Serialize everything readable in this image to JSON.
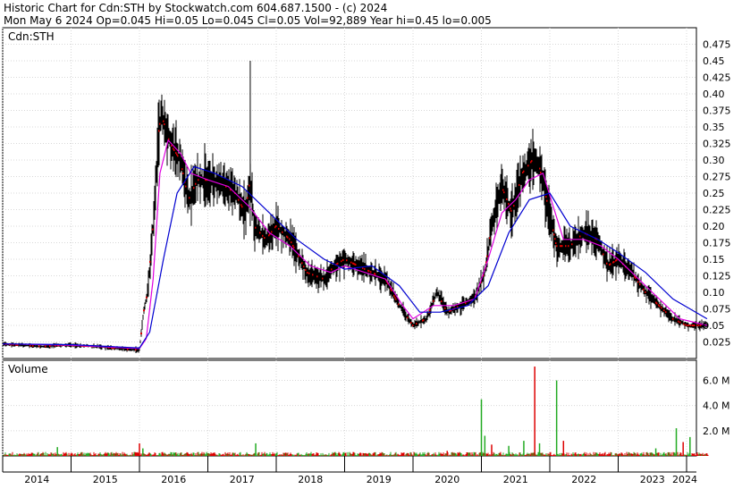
{
  "header": {
    "line1": "Historic Chart for Cdn:STH by Stockwatch.com 604.687.1500 - (c) 2024",
    "line2": "Mon May  6 2024   Op=0.045   Hi=0.05   Lo=0.045   Cl=0.05   Vol=92,889   Year hi=0.45   lo=0.005"
  },
  "colors": {
    "price_bar": "#000000",
    "down_mark": "#e00000",
    "ma_short": "#e000e0",
    "ma_long": "#0000d0",
    "vol_up": "#22aa22",
    "vol_down": "#dd0000",
    "grid": "#d8d8d8",
    "frame": "#000000"
  },
  "chart_data": [
    {
      "type": "line",
      "title": "Cdn:STH",
      "x_unit": "year",
      "xlim": [
        2014,
        2024.35
      ],
      "ylim": [
        0,
        0.5
      ],
      "grid": true,
      "y_ticks": [
        "0.025",
        "0.05",
        "0.075",
        "0.10",
        "0.125",
        "0.15",
        "0.175",
        "0.20",
        "0.225",
        "0.25",
        "0.275",
        "0.30",
        "0.325",
        "0.35",
        "0.375",
        "0.40",
        "0.425",
        "0.45",
        "0.475"
      ],
      "x_ticks": [
        "2014",
        "2015",
        "2016",
        "2017",
        "2018",
        "2019",
        "2020",
        "2021",
        "2022",
        "2023",
        "2024"
      ],
      "series": [
        {
          "role": "price",
          "points": [
            [
              2014.0,
              0.022
            ],
            [
              2014.3,
              0.02
            ],
            [
              2014.6,
              0.018
            ],
            [
              2014.85,
              0.02
            ],
            [
              2015.0,
              0.02
            ],
            [
              2015.4,
              0.018
            ],
            [
              2015.8,
              0.014
            ],
            [
              2016.0,
              0.013
            ],
            [
              2016.06,
              0.07
            ],
            [
              2016.12,
              0.1
            ],
            [
              2016.2,
              0.2
            ],
            [
              2016.27,
              0.33
            ],
            [
              2016.32,
              0.37
            ],
            [
              2016.45,
              0.325
            ],
            [
              2016.6,
              0.3
            ],
            [
              2016.72,
              0.24
            ],
            [
              2016.85,
              0.27
            ],
            [
              2017.0,
              0.27
            ],
            [
              2017.2,
              0.265
            ],
            [
              2017.4,
              0.25
            ],
            [
              2017.55,
              0.22
            ],
            [
              2017.62,
              0.27
            ],
            [
              2017.68,
              0.2
            ],
            [
              2017.85,
              0.18
            ],
            [
              2018.0,
              0.2
            ],
            [
              2018.2,
              0.18
            ],
            [
              2018.45,
              0.13
            ],
            [
              2018.7,
              0.12
            ],
            [
              2018.85,
              0.14
            ],
            [
              2019.0,
              0.15
            ],
            [
              2019.2,
              0.14
            ],
            [
              2019.4,
              0.13
            ],
            [
              2019.6,
              0.12
            ],
            [
              2019.8,
              0.08
            ],
            [
              2020.0,
              0.05
            ],
            [
              2020.2,
              0.06
            ],
            [
              2020.35,
              0.1
            ],
            [
              2020.5,
              0.07
            ],
            [
              2020.7,
              0.08
            ],
            [
              2020.9,
              0.09
            ],
            [
              2021.05,
              0.13
            ],
            [
              2021.15,
              0.2
            ],
            [
              2021.3,
              0.26
            ],
            [
              2021.45,
              0.22
            ],
            [
              2021.6,
              0.28
            ],
            [
              2021.75,
              0.3
            ],
            [
              2021.85,
              0.29
            ],
            [
              2022.0,
              0.22
            ],
            [
              2022.1,
              0.17
            ],
            [
              2022.3,
              0.17
            ],
            [
              2022.5,
              0.19
            ],
            [
              2022.7,
              0.18
            ],
            [
              2022.85,
              0.14
            ],
            [
              2023.0,
              0.15
            ],
            [
              2023.2,
              0.13
            ],
            [
              2023.4,
              0.1
            ],
            [
              2023.6,
              0.08
            ],
            [
              2023.8,
              0.06
            ],
            [
              2024.0,
              0.05
            ],
            [
              2024.3,
              0.05
            ]
          ]
        },
        {
          "role": "moving-average-short",
          "points": [
            [
              2014.0,
              0.022
            ],
            [
              2015.0,
              0.02
            ],
            [
              2016.0,
              0.015
            ],
            [
              2016.1,
              0.03
            ],
            [
              2016.2,
              0.12
            ],
            [
              2016.3,
              0.28
            ],
            [
              2016.42,
              0.33
            ],
            [
              2016.6,
              0.31
            ],
            [
              2016.75,
              0.28
            ],
            [
              2017.0,
              0.27
            ],
            [
              2017.3,
              0.26
            ],
            [
              2017.6,
              0.23
            ],
            [
              2017.9,
              0.19
            ],
            [
              2018.2,
              0.17
            ],
            [
              2018.5,
              0.14
            ],
            [
              2018.8,
              0.13
            ],
            [
              2019.0,
              0.14
            ],
            [
              2019.3,
              0.13
            ],
            [
              2019.6,
              0.12
            ],
            [
              2019.85,
              0.08
            ],
            [
              2020.0,
              0.06
            ],
            [
              2020.3,
              0.08
            ],
            [
              2020.6,
              0.08
            ],
            [
              2020.9,
              0.09
            ],
            [
              2021.1,
              0.15
            ],
            [
              2021.3,
              0.22
            ],
            [
              2021.5,
              0.24
            ],
            [
              2021.7,
              0.27
            ],
            [
              2021.9,
              0.28
            ],
            [
              2022.05,
              0.23
            ],
            [
              2022.2,
              0.18
            ],
            [
              2022.5,
              0.18
            ],
            [
              2022.75,
              0.17
            ],
            [
              2023.0,
              0.15
            ],
            [
              2023.3,
              0.12
            ],
            [
              2023.6,
              0.09
            ],
            [
              2023.9,
              0.06
            ],
            [
              2024.3,
              0.05
            ]
          ]
        },
        {
          "role": "moving-average-long",
          "points": [
            [
              2014.0,
              0.022
            ],
            [
              2015.0,
              0.021
            ],
            [
              2016.0,
              0.016
            ],
            [
              2016.15,
              0.04
            ],
            [
              2016.35,
              0.15
            ],
            [
              2016.55,
              0.25
            ],
            [
              2016.8,
              0.29
            ],
            [
              2017.1,
              0.28
            ],
            [
              2017.5,
              0.26
            ],
            [
              2017.9,
              0.22
            ],
            [
              2018.3,
              0.18
            ],
            [
              2018.7,
              0.15
            ],
            [
              2019.0,
              0.135
            ],
            [
              2019.4,
              0.14
            ],
            [
              2019.8,
              0.11
            ],
            [
              2020.1,
              0.07
            ],
            [
              2020.4,
              0.07
            ],
            [
              2020.8,
              0.08
            ],
            [
              2021.1,
              0.11
            ],
            [
              2021.4,
              0.19
            ],
            [
              2021.7,
              0.24
            ],
            [
              2022.0,
              0.25
            ],
            [
              2022.3,
              0.2
            ],
            [
              2022.7,
              0.18
            ],
            [
              2023.0,
              0.16
            ],
            [
              2023.4,
              0.13
            ],
            [
              2023.8,
              0.09
            ],
            [
              2024.3,
              0.06
            ]
          ]
        }
      ]
    },
    {
      "type": "bar",
      "title": "Volume",
      "x_unit": "year",
      "xlim": [
        2014,
        2024.35
      ],
      "ylim": [
        0,
        7600000
      ],
      "y_ticks": [
        "2.0 M",
        "4.0 M",
        "6.0 M"
      ],
      "typical_daily_volume": 150000,
      "spikes": [
        [
          2014.8,
          700000
        ],
        [
          2016.0,
          1000000
        ],
        [
          2016.05,
          600000
        ],
        [
          2017.7,
          1000000
        ],
        [
          2020.5,
          400000
        ],
        [
          2021.0,
          4500000
        ],
        [
          2021.05,
          1600000
        ],
        [
          2021.15,
          900000
        ],
        [
          2021.4,
          800000
        ],
        [
          2021.62,
          1200000
        ],
        [
          2021.78,
          7100000
        ],
        [
          2021.85,
          1000000
        ],
        [
          2022.1,
          6000000
        ],
        [
          2022.2,
          1200000
        ],
        [
          2023.55,
          600000
        ],
        [
          2023.85,
          2200000
        ],
        [
          2023.95,
          1100000
        ],
        [
          2024.05,
          1500000
        ]
      ]
    }
  ]
}
